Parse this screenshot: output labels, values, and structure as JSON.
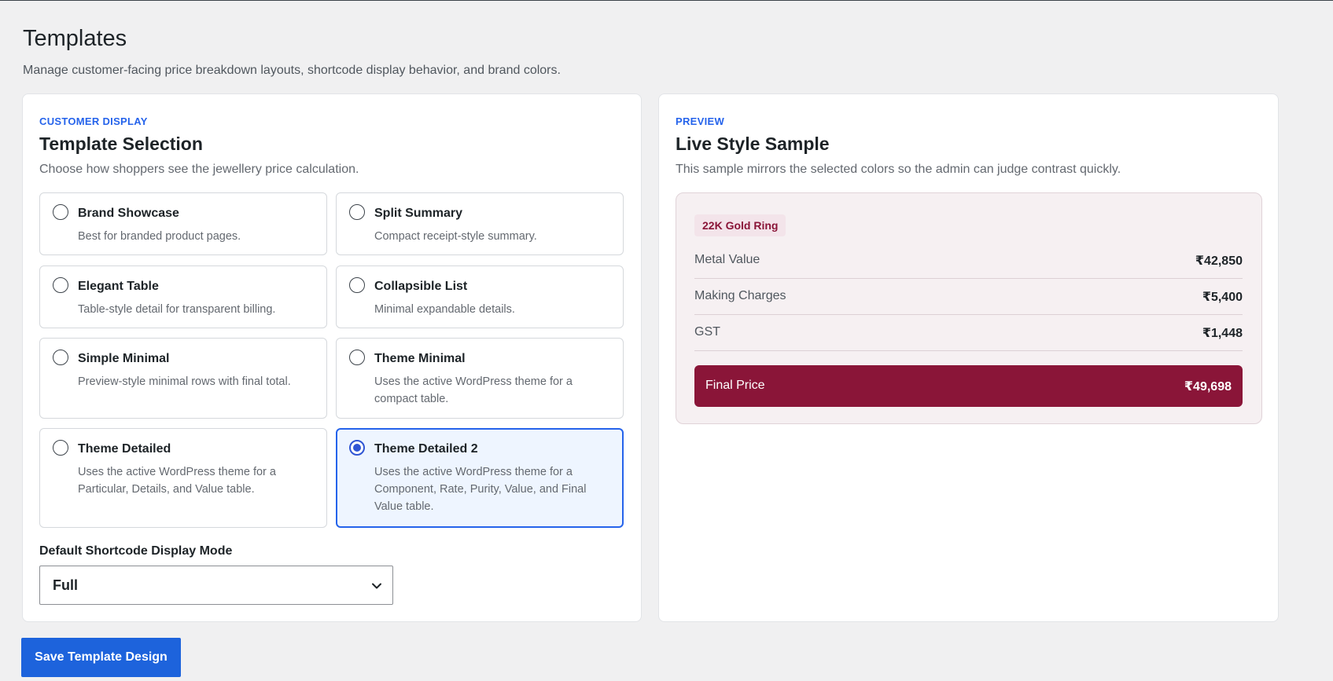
{
  "page": {
    "title": "Templates",
    "subtitle": "Manage customer-facing price breakdown layouts, shortcode display behavior, and brand colors."
  },
  "customer_display": {
    "eyebrow": "CUSTOMER DISPLAY",
    "title": "Template Selection",
    "description": "Choose how shoppers see the jewellery price calculation.",
    "options": [
      {
        "label": "Brand Showcase",
        "desc": "Best for branded product pages.",
        "selected": false
      },
      {
        "label": "Split Summary",
        "desc": "Compact receipt-style summary.",
        "selected": false
      },
      {
        "label": "Elegant Table",
        "desc": "Table-style detail for transparent billing.",
        "selected": false
      },
      {
        "label": "Collapsible List",
        "desc": "Minimal expandable details.",
        "selected": false
      },
      {
        "label": "Simple Minimal",
        "desc": "Preview-style minimal rows with final total.",
        "selected": false
      },
      {
        "label": "Theme Minimal",
        "desc": "Uses the active WordPress theme for a compact table.",
        "selected": false
      },
      {
        "label": "Theme Detailed",
        "desc": "Uses the active WordPress theme for a Particular, Details, and Value table.",
        "selected": false
      },
      {
        "label": "Theme Detailed 2",
        "desc": "Uses the active WordPress theme for a Component, Rate, Purity, Value, and Final Value table.",
        "selected": true
      }
    ],
    "shortcode": {
      "label": "Default Shortcode Display Mode",
      "value": "Full"
    }
  },
  "preview": {
    "eyebrow": "PREVIEW",
    "title": "Live Style Sample",
    "description": "This sample mirrors the selected colors so the admin can judge contrast quickly.",
    "badge": "22K Gold Ring",
    "rows": [
      {
        "label": "Metal Value",
        "value": "₹42,850"
      },
      {
        "label": "Making Charges",
        "value": "₹5,400"
      },
      {
        "label": "GST",
        "value": "₹1,448"
      }
    ],
    "final": {
      "label": "Final Price",
      "value": "₹49,698"
    }
  },
  "actions": {
    "save_label": "Save Template Design"
  },
  "colors": {
    "accent": "#2563eb",
    "brand": "#8a1538",
    "button": "#1d63dc"
  }
}
